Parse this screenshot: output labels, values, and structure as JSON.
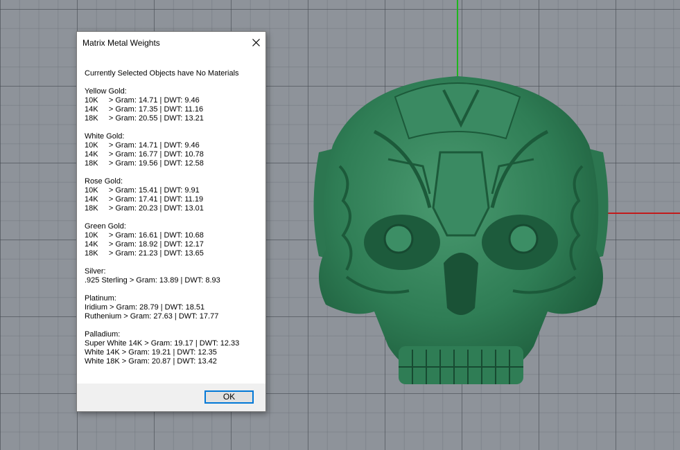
{
  "dialog": {
    "title": "Matrix Metal Weights",
    "message": "Currently Selected Objects have No Materials",
    "ok_label": "OK",
    "groups": [
      {
        "heading": "Yellow Gold:",
        "lines": [
          "10K     > Gram: 14.71 | DWT: 9.46",
          "14K     > Gram: 17.35 | DWT: 11.16",
          "18K     > Gram: 20.55 | DWT: 13.21"
        ]
      },
      {
        "heading": "White Gold:",
        "lines": [
          "10K     > Gram: 14.71 | DWT: 9.46",
          "14K     > Gram: 16.77 | DWT: 10.78",
          "18K     > Gram: 19.56 | DWT: 12.58"
        ]
      },
      {
        "heading": "Rose Gold:",
        "lines": [
          "10K     > Gram: 15.41 | DWT: 9.91",
          "14K     > Gram: 17.41 | DWT: 11.19",
          "18K     > Gram: 20.23 | DWT: 13.01"
        ]
      },
      {
        "heading": "Green Gold:",
        "lines": [
          "10K     > Gram: 16.61 | DWT: 10.68",
          "14K     > Gram: 18.92 | DWT: 12.17",
          "18K     > Gram: 21.23 | DWT: 13.65"
        ]
      },
      {
        "heading": "Silver:",
        "lines": [
          ".925 Sterling > Gram: 13.89 | DWT: 8.93"
        ]
      },
      {
        "heading": "Platinum:",
        "lines": [
          "Iridium > Gram: 28.79 | DWT: 18.51",
          "Ruthenium > Gram: 27.63 | DWT: 17.77"
        ]
      },
      {
        "heading": "Palladium:",
        "lines": [
          "Super White 14K > Gram: 19.17 | DWT: 12.33",
          "White 14K > Gram: 19.21 | DWT: 12.35",
          "White 18K > Gram: 20.87 | DWT: 13.42"
        ]
      }
    ]
  },
  "icons": {
    "close": "close-icon"
  },
  "colors": {
    "model_green": "#2f7d55",
    "axis_x": "#c21a1a",
    "axis_y": "#1db81d",
    "viewport_bg": "#8e939a",
    "ok_border": "#0078d7"
  }
}
